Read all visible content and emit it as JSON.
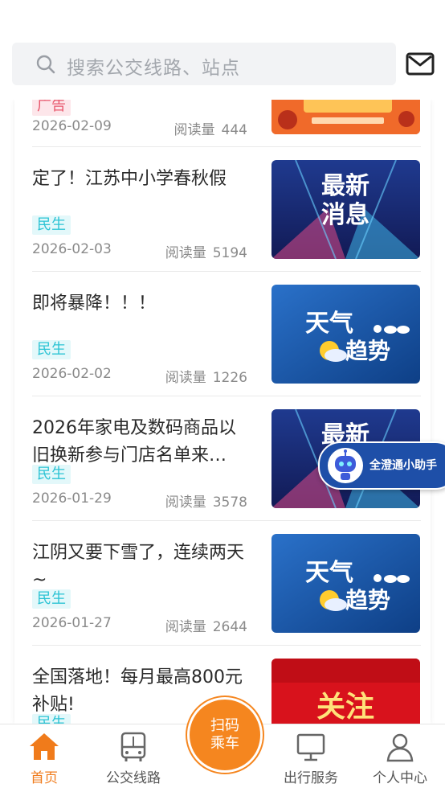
{
  "search": {
    "placeholder": "搜索公交线路、站点"
  },
  "feed": {
    "items": [
      {
        "title": "",
        "tag": "广告",
        "date": "2026-02-09",
        "reads_label": "阅读量",
        "reads": "444",
        "thumb": "festival-banner"
      },
      {
        "title": "定了！江苏中小学春秋假",
        "tag": "民生",
        "date": "2026-02-03",
        "reads_label": "阅读量",
        "reads": "5194",
        "thumb": "latest-news",
        "thumb_text": [
          "最新",
          "消息"
        ]
      },
      {
        "title": "即将暴降！！！",
        "tag": "民生",
        "date": "2026-02-02",
        "reads_label": "阅读量",
        "reads": "1226",
        "thumb": "weather-trend",
        "thumb_text": [
          "天气",
          "趋势"
        ]
      },
      {
        "title": "2026年家电及数码商品以旧换新参与门店名单来…",
        "tag": "民生",
        "date": "2026-01-29",
        "reads_label": "阅读量",
        "reads": "3578",
        "thumb": "latest-news",
        "thumb_text": [
          "最新",
          "消息"
        ]
      },
      {
        "title": "江阴又要下雪了，连续两天~",
        "tag": "民生",
        "date": "2026-01-27",
        "reads_label": "阅读量",
        "reads": "2644",
        "thumb": "weather-trend",
        "thumb_text": [
          "天气",
          "趋势"
        ]
      },
      {
        "title": "全国落地！每月最高800元补贴!",
        "tag": "民生",
        "date": "",
        "reads_label": "",
        "reads": "",
        "thumb": "attention",
        "thumb_text": [
          "关注"
        ]
      }
    ]
  },
  "assistant": {
    "label": "全澄通小助手",
    "icon": "robot-icon"
  },
  "tabbar": {
    "tabs": [
      {
        "label": "首页",
        "icon": "home-icon",
        "active": true
      },
      {
        "label": "公交线路",
        "icon": "bus-icon",
        "active": false
      },
      {
        "label": "出行服务",
        "icon": "monitor-icon",
        "active": false
      },
      {
        "label": "个人中心",
        "icon": "user-icon",
        "active": false
      }
    ],
    "scan_line1": "扫码",
    "scan_line2": "乘车"
  },
  "colors": {
    "accent": "#f07b1b",
    "tag": "#2cc3d4",
    "assistant": "#1e4fa8"
  }
}
